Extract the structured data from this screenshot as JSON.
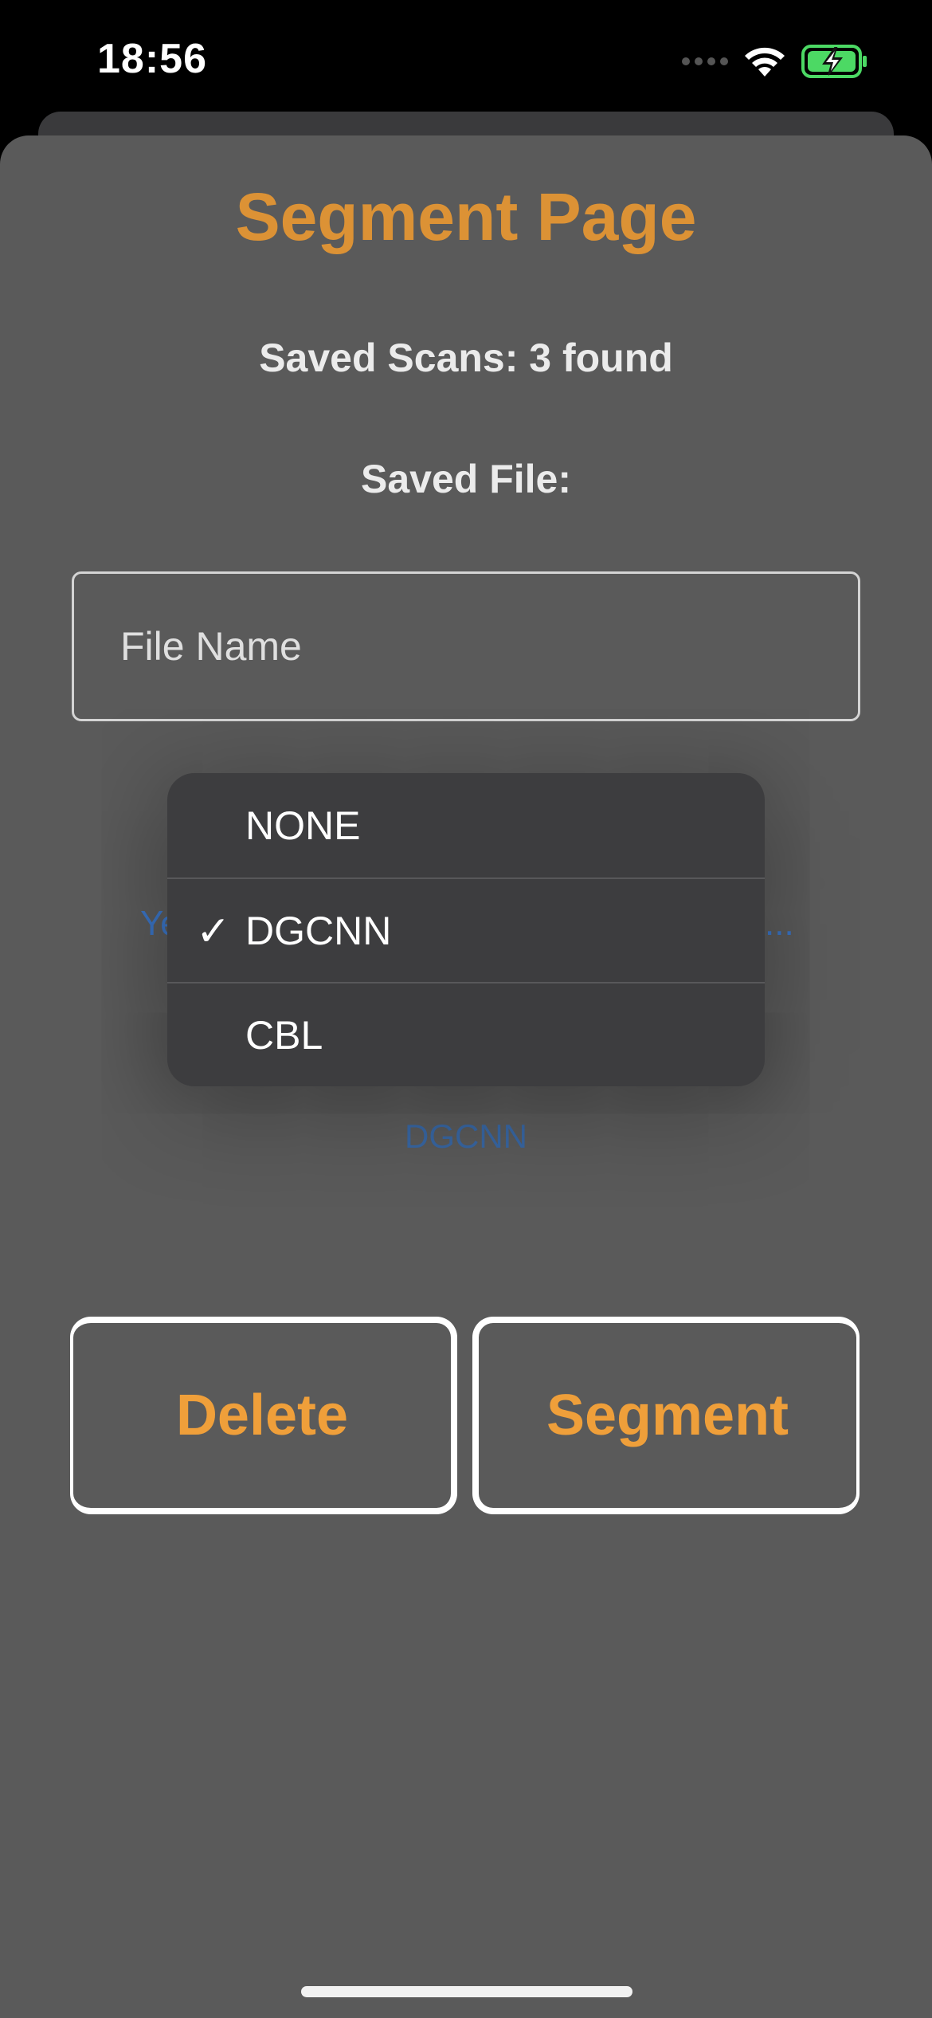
{
  "status_bar": {
    "time": "18:56",
    "icons": [
      "signal-dots-icon",
      "wifi-icon",
      "battery-charging-icon"
    ]
  },
  "page": {
    "title": "Segment Page",
    "saved_scans": "Saved Scans: 3 found",
    "saved_file_label": "Saved File:",
    "file_input": {
      "placeholder": "File Name",
      "value": ""
    }
  },
  "background_row": {
    "left_text": "Ye",
    "right_text": "..."
  },
  "picker": {
    "selected": "DGCNN",
    "options": [
      {
        "label": "NONE",
        "checked": false
      },
      {
        "label": "DGCNN",
        "checked": true
      },
      {
        "label": "CBL",
        "checked": false
      }
    ],
    "check_mark": "✓"
  },
  "buttons": {
    "delete": "Delete",
    "segment": "Segment"
  },
  "colors": {
    "accent": "#ef9f3a",
    "sheet_bg": "#626262",
    "menu_bg": "#3d3d3f",
    "link_blue": "#3f7ed6"
  }
}
